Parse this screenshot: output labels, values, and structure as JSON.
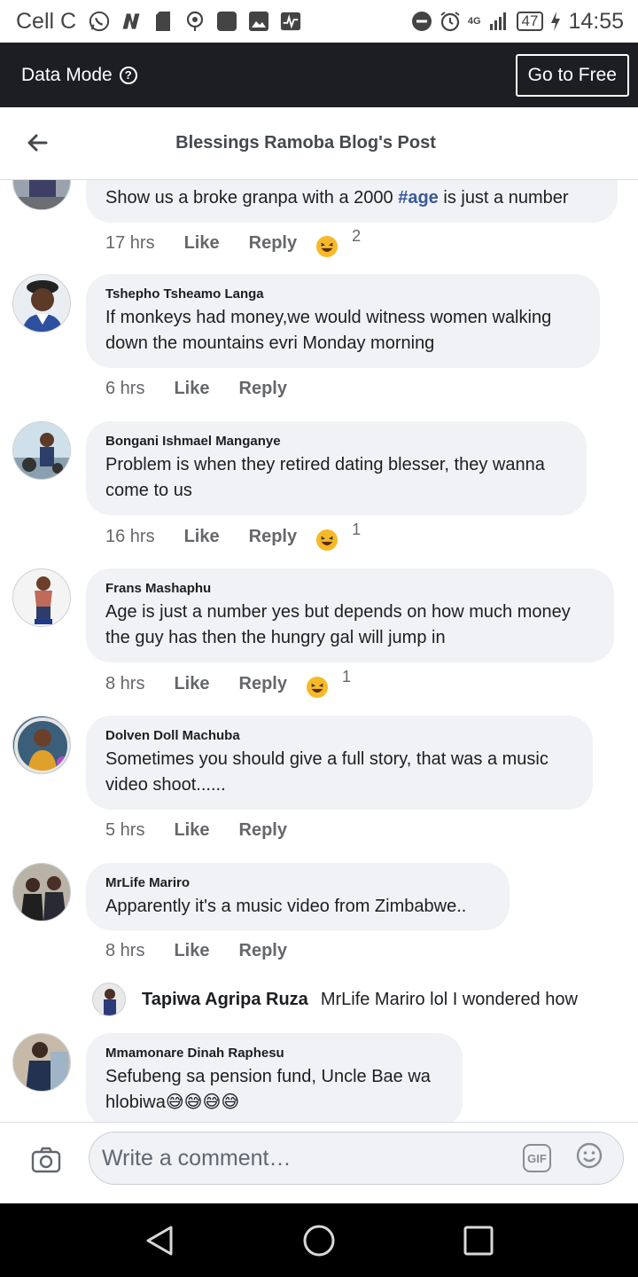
{
  "status_bar": {
    "carrier": "Cell C",
    "network": "4G",
    "battery": "47",
    "time": "14:55",
    "icons": [
      "whatsapp-icon",
      "n-icon",
      "sd-card-icon",
      "cast-icon",
      "square-app-icon",
      "image-icon",
      "activity-icon",
      "dnd-icon",
      "alarm-icon",
      "signal-icon",
      "charging-icon"
    ]
  },
  "data_bar": {
    "label": "Data Mode",
    "help_glyph": "?",
    "button": "Go to Free"
  },
  "header": {
    "title": "Blessings Ramoba Blog's Post"
  },
  "comments": [
    {
      "name": "",
      "text_before": "Show us a broke granpa  with a 2000 ",
      "hashtag": "#age",
      "text_after": " is just a number",
      "time": "17 hrs",
      "like": "Like",
      "reply": "Reply",
      "reactions": "2"
    },
    {
      "name": "Tshepho Tsheamo Langa",
      "text": "If monkeys had money,we would witness women walking down the mountains evri Monday morning",
      "time": "6 hrs",
      "like": "Like",
      "reply": "Reply"
    },
    {
      "name": "Bongani Ishmael Manganye",
      "text": "Problem is when they retired dating blesser, they wanna come to us",
      "time": "16 hrs",
      "like": "Like",
      "reply": "Reply",
      "reactions": "1"
    },
    {
      "name": "Frans Mashaphu",
      "text": "Age is just a number yes but depends on how much money the guy has then the hungry gal will jump in",
      "time": "8 hrs",
      "like": "Like",
      "reply": "Reply",
      "reactions": "1"
    },
    {
      "name": "Dolven Doll Machuba",
      "text": "Sometimes you should give a full story, that was a music video shoot......",
      "time": "5 hrs",
      "like": "Like",
      "reply": "Reply"
    },
    {
      "name": "MrLife Mariro",
      "text": "Apparently it's a music video from Zimbabwe..",
      "time": "8 hrs",
      "like": "Like",
      "reply": "Reply"
    },
    {
      "name": "Mmamonare Dinah Raphesu",
      "text": "Sefubeng sa pension fund, Uncle Bae wa hlobiwa😅😅😅😅"
    }
  ],
  "reply_preview": {
    "name": "Tapiwa Agripa Ruza",
    "text": "MrLife Mariro lol I wondered how"
  },
  "composer": {
    "placeholder": "Write a comment…",
    "gif": "GIF"
  },
  "colors": {
    "data_bar": "#1c1e21",
    "bubble": "#f0f2f5",
    "hashtag": "#385898",
    "haha": "#f7b928"
  }
}
